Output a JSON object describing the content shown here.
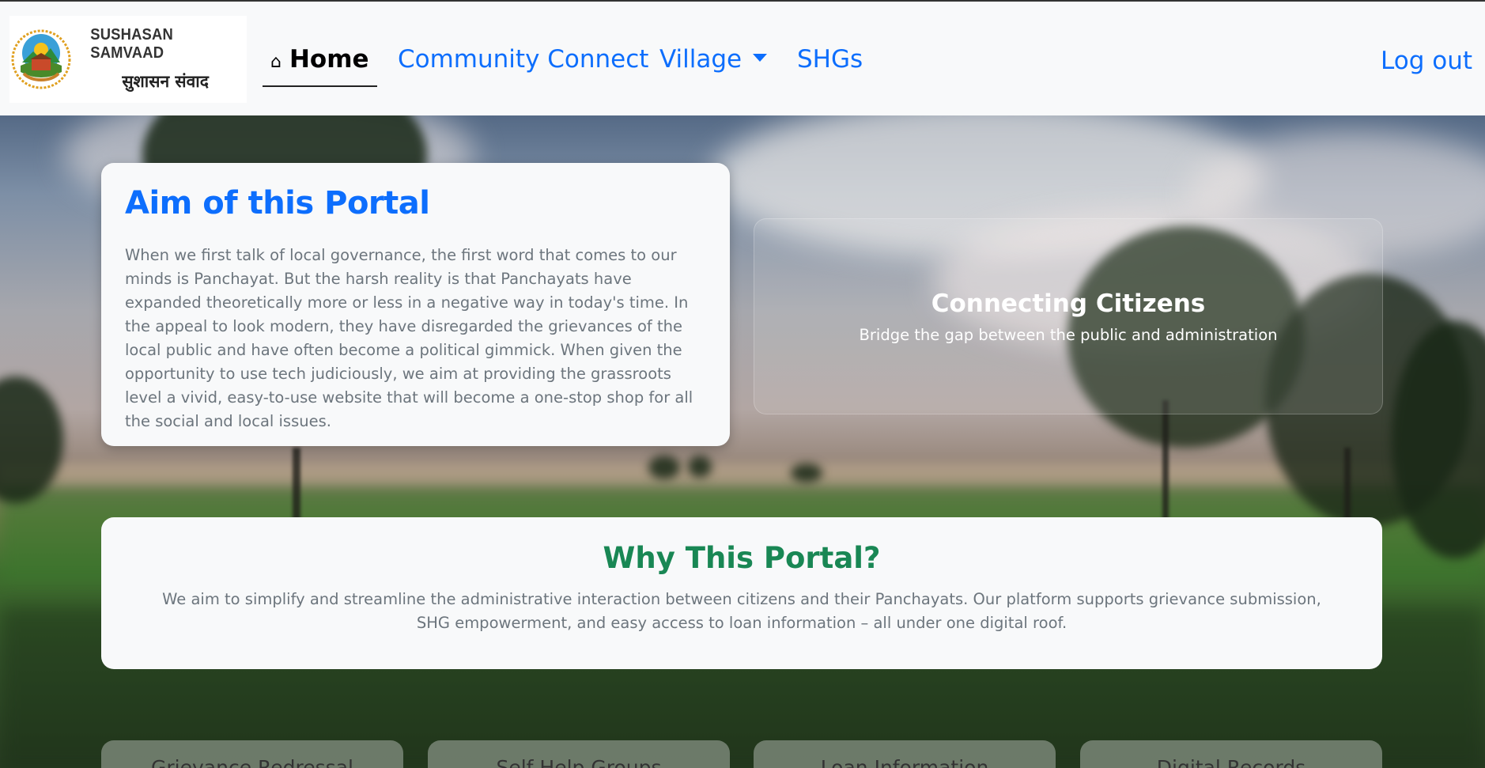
{
  "navbar": {
    "brand_en": "SUSHASAN SAMVAAD",
    "brand_hi": "सुशासन संवाद",
    "home_icon": "home-icon",
    "home_label": "Home",
    "community_label": "Community Connect",
    "village_label": "Village",
    "shg_label": "SHGs",
    "logout_label": "Log out"
  },
  "aim": {
    "title": "Aim of this Portal",
    "text": "When we first talk of local governance, the first word that comes to our minds is Panchayat. But the harsh reality is that Panchayats have expanded theoretically more or less in a negative way in today's time. In the appeal to look modern, they have disregarded the grievances of the local public and have often become a political gimmick. When given the opportunity to use tech judiciously, we aim at providing the grassroots level a vivid, easy-to-use website that will become a one-stop shop for all the social and local issues."
  },
  "connect": {
    "title": "Connecting Citizens",
    "subtitle": "Bridge the gap between the public and administration"
  },
  "why": {
    "title": "Why This Portal?",
    "text": "We aim to simplify and streamline the administrative interaction between citizens and their Panchayats. Our platform supports grievance submission, SHG empowerment, and easy access to loan information – all under one digital roof."
  },
  "features": [
    {
      "label": "Grievance Redressal"
    },
    {
      "label": "Self Help Groups"
    },
    {
      "label": "Loan Information"
    },
    {
      "label": "Digital Records"
    }
  ],
  "colors": {
    "primary": "#0d6efd",
    "success": "#198754",
    "muted": "#6c757d",
    "light": "#f8f9fa"
  }
}
